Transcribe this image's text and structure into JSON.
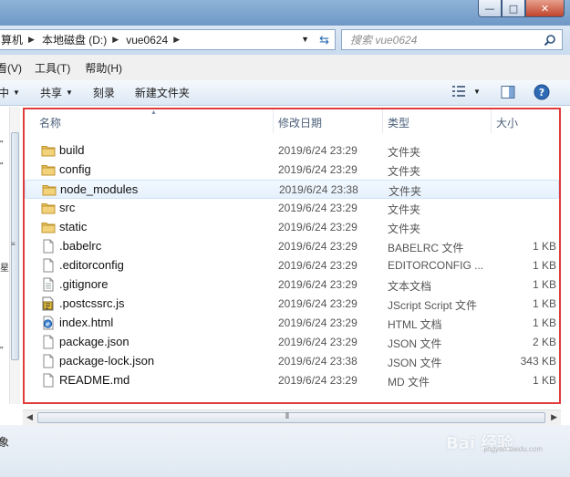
{
  "window": {
    "min_glyph": "—",
    "max_glyph": "□",
    "close_glyph": "✕"
  },
  "address": {
    "crumbs": [
      "算机",
      "本地磁盘 (D:)",
      "vue0624"
    ],
    "search_placeholder": "搜索 vue0624"
  },
  "menu": {
    "items": [
      "看(V)",
      "工具(T)",
      "帮助(H)"
    ]
  },
  "toolbar": {
    "include_label": "中",
    "share_label": "共享",
    "burn_label": "刻录",
    "new_folder_label": "新建文件夹"
  },
  "nav": {
    "texts": [
      "\"",
      "\"",
      "星",
      "\""
    ]
  },
  "columns": {
    "name": "名称",
    "date": "修改日期",
    "type": "类型",
    "size": "大小"
  },
  "files": [
    {
      "name": "build",
      "date": "2019/6/24 23:29",
      "type": "文件夹",
      "size": "",
      "icon": "folder-icon"
    },
    {
      "name": "config",
      "date": "2019/6/24 23:29",
      "type": "文件夹",
      "size": "",
      "icon": "folder-icon"
    },
    {
      "name": "node_modules",
      "date": "2019/6/24 23:38",
      "type": "文件夹",
      "size": "",
      "icon": "folder-icon"
    },
    {
      "name": "src",
      "date": "2019/6/24 23:29",
      "type": "文件夹",
      "size": "",
      "icon": "folder-icon"
    },
    {
      "name": "static",
      "date": "2019/6/24 23:29",
      "type": "文件夹",
      "size": "",
      "icon": "folder-icon"
    },
    {
      "name": ".babelrc",
      "date": "2019/6/24 23:29",
      "type": "BABELRC 文件",
      "size": "1 KB",
      "icon": "file-icon"
    },
    {
      "name": ".editorconfig",
      "date": "2019/6/24 23:29",
      "type": "EDITORCONFIG ...",
      "size": "1 KB",
      "icon": "file-icon"
    },
    {
      "name": ".gitignore",
      "date": "2019/6/24 23:29",
      "type": "文本文档",
      "size": "1 KB",
      "icon": "text-file-icon"
    },
    {
      "name": ".postcssrc.js",
      "date": "2019/6/24 23:29",
      "type": "JScript Script 文件",
      "size": "1 KB",
      "icon": "script-file-icon"
    },
    {
      "name": "index.html",
      "date": "2019/6/24 23:29",
      "type": "HTML 文档",
      "size": "1 KB",
      "icon": "html-file-icon"
    },
    {
      "name": "package.json",
      "date": "2019/6/24 23:29",
      "type": "JSON 文件",
      "size": "2 KB",
      "icon": "file-icon"
    },
    {
      "name": "package-lock.json",
      "date": "2019/6/24 23:38",
      "type": "JSON 文件",
      "size": "343 KB",
      "icon": "file-icon"
    },
    {
      "name": "README.md",
      "date": "2019/6/24 23:29",
      "type": "MD 文件",
      "size": "1 KB",
      "icon": "file-icon"
    }
  ],
  "status": {
    "left_text": "象"
  },
  "watermark": {
    "text": "Bai 经验",
    "sub": "jingyan.baidu.com"
  },
  "colors": {
    "highlight_border": "#e03c3c",
    "folder": "#e8c15a",
    "hover_row": "#e6f1fd"
  }
}
